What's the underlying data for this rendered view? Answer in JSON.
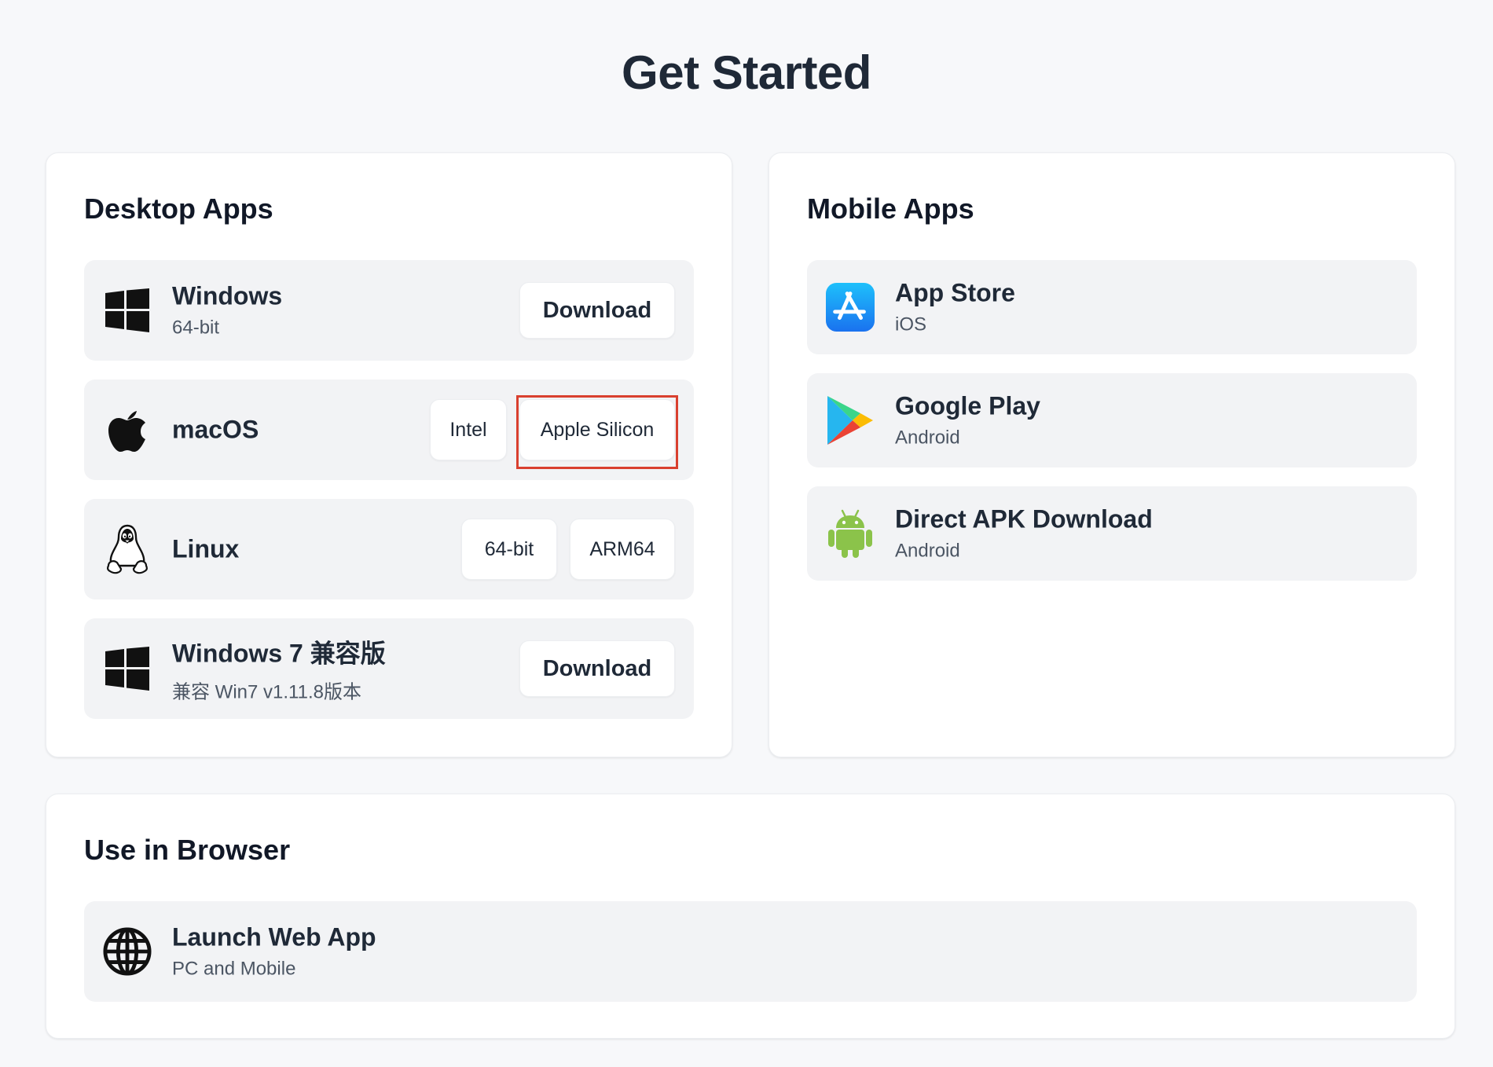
{
  "page": {
    "title": "Get Started"
  },
  "desktop": {
    "title": "Desktop Apps",
    "windows": {
      "name": "Windows",
      "sub": "64-bit",
      "download_label": "Download",
      "icon": "windows-icon"
    },
    "macos": {
      "name": "macOS",
      "intel_label": "Intel",
      "apple_silicon_label": "Apple Silicon",
      "icon": "apple-icon"
    },
    "linux": {
      "name": "Linux",
      "bit64_label": "64-bit",
      "arm64_label": "ARM64",
      "icon": "linux-penguin-icon"
    },
    "windows7": {
      "name": "Windows 7 兼容版",
      "sub": "兼容 Win7 v1.11.8版本",
      "download_label": "Download",
      "icon": "windows-icon"
    }
  },
  "mobile": {
    "title": "Mobile Apps",
    "app_store": {
      "name": "App Store",
      "sub": "iOS",
      "icon": "app-store-icon"
    },
    "google_play": {
      "name": "Google Play",
      "sub": "Android",
      "icon": "google-play-icon"
    },
    "apk": {
      "name": "Direct APK Download",
      "sub": "Android",
      "icon": "android-icon"
    }
  },
  "browser": {
    "title": "Use in Browser",
    "web_app": {
      "name": "Launch Web App",
      "sub": "PC and Mobile",
      "icon": "globe-icon"
    }
  },
  "colors": {
    "background": "#f7f8fa",
    "card": "#ffffff",
    "row": "#f2f3f5",
    "highlight": "#d9402f",
    "android_green": "#8bc34a",
    "app_store_blue": "#1a8cff"
  }
}
